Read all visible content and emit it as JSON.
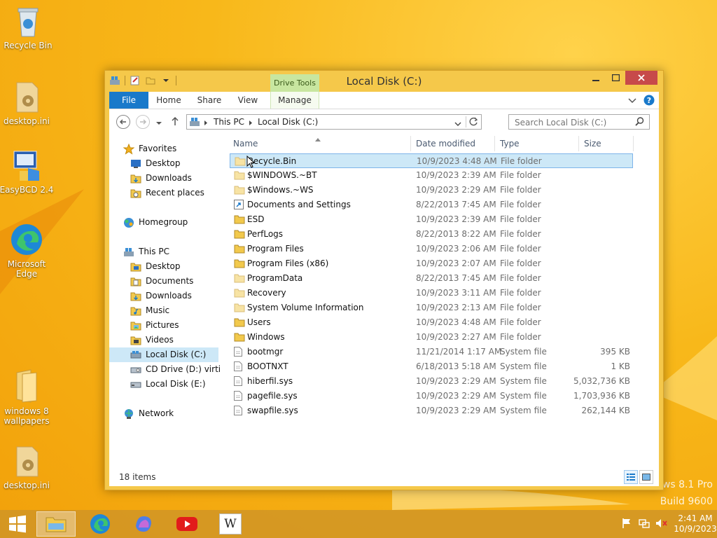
{
  "desktop": {
    "icons": [
      {
        "label": "Recycle Bin"
      },
      {
        "label": "desktop.ini"
      },
      {
        "label": "EasyBCD 2.4"
      },
      {
        "label": "Microsoft Edge"
      },
      {
        "label": "windows 8 wallpapers"
      },
      {
        "label": "desktop.ini"
      }
    ],
    "watermark_line1": "ws 8.1 Pro",
    "watermark_line2": "Build 9600"
  },
  "window": {
    "title": "Local Disk (C:)",
    "contextual_tab_group": "Drive Tools",
    "tabs": [
      "File",
      "Home",
      "Share",
      "View",
      "Manage"
    ],
    "address": {
      "crumbs": [
        "This PC",
        "Local Disk (C:)"
      ]
    },
    "search": {
      "placeholder": "Search Local Disk (C:)"
    },
    "nav": {
      "favorites": {
        "label": "Favorites",
        "items": [
          "Desktop",
          "Downloads",
          "Recent places"
        ]
      },
      "homegroup": "Homegroup",
      "this_pc": {
        "label": "This PC",
        "items": [
          "Desktop",
          "Documents",
          "Downloads",
          "Music",
          "Pictures",
          "Videos",
          "Local Disk (C:)",
          "CD Drive (D:) virtio-w",
          "Local Disk (E:)"
        ]
      },
      "network": "Network"
    },
    "columns": {
      "name": "Name",
      "date": "Date modified",
      "type": "Type",
      "size": "Size"
    },
    "files": [
      {
        "name": "Recycle.Bin",
        "date": "10/9/2023 4:48 AM",
        "type": "File folder",
        "size": "",
        "icon": "folder-faded"
      },
      {
        "name": "$WINDOWS.~BT",
        "date": "10/9/2023 2:39 AM",
        "type": "File folder",
        "size": "",
        "icon": "folder-faded"
      },
      {
        "name": "$Windows.~WS",
        "date": "10/9/2023 2:29 AM",
        "type": "File folder",
        "size": "",
        "icon": "folder-faded"
      },
      {
        "name": "Documents and Settings",
        "date": "8/22/2013 7:45 AM",
        "type": "File folder",
        "size": "",
        "icon": "shortcut"
      },
      {
        "name": "ESD",
        "date": "10/9/2023 2:39 AM",
        "type": "File folder",
        "size": "",
        "icon": "folder"
      },
      {
        "name": "PerfLogs",
        "date": "8/22/2013 8:22 AM",
        "type": "File folder",
        "size": "",
        "icon": "folder"
      },
      {
        "name": "Program Files",
        "date": "10/9/2023 2:06 AM",
        "type": "File folder",
        "size": "",
        "icon": "folder"
      },
      {
        "name": "Program Files (x86)",
        "date": "10/9/2023 2:07 AM",
        "type": "File folder",
        "size": "",
        "icon": "folder"
      },
      {
        "name": "ProgramData",
        "date": "8/22/2013 7:45 AM",
        "type": "File folder",
        "size": "",
        "icon": "folder-faded"
      },
      {
        "name": "Recovery",
        "date": "10/9/2023 3:11 AM",
        "type": "File folder",
        "size": "",
        "icon": "folder-faded"
      },
      {
        "name": "System Volume Information",
        "date": "10/9/2023 2:13 AM",
        "type": "File folder",
        "size": "",
        "icon": "folder-faded"
      },
      {
        "name": "Users",
        "date": "10/9/2023 4:48 AM",
        "type": "File folder",
        "size": "",
        "icon": "folder"
      },
      {
        "name": "Windows",
        "date": "10/9/2023 2:27 AM",
        "type": "File folder",
        "size": "",
        "icon": "folder"
      },
      {
        "name": "bootmgr",
        "date": "11/21/2014 1:17 AM",
        "type": "System file",
        "size": "395 KB",
        "icon": "file"
      },
      {
        "name": "BOOTNXT",
        "date": "6/18/2013 5:18 AM",
        "type": "System file",
        "size": "1 KB",
        "icon": "file"
      },
      {
        "name": "hiberfil.sys",
        "date": "10/9/2023 2:29 AM",
        "type": "System file",
        "size": "5,032,736 KB",
        "icon": "file"
      },
      {
        "name": "pagefile.sys",
        "date": "10/9/2023 2:29 AM",
        "type": "System file",
        "size": "1,703,936 KB",
        "icon": "file"
      },
      {
        "name": "swapfile.sys",
        "date": "10/9/2023 2:29 AM",
        "type": "System file",
        "size": "262,144 KB",
        "icon": "file"
      }
    ],
    "status": "18 items"
  },
  "taskbar": {
    "clock_time": "2:41 AM",
    "clock_date": "10/9/2023",
    "wiki_letter": "W"
  },
  "colors": {
    "accent": "#1979ca",
    "selection": "#cde8f7",
    "close": "#c74a4a",
    "drive_tools": "#c8e6a0"
  }
}
